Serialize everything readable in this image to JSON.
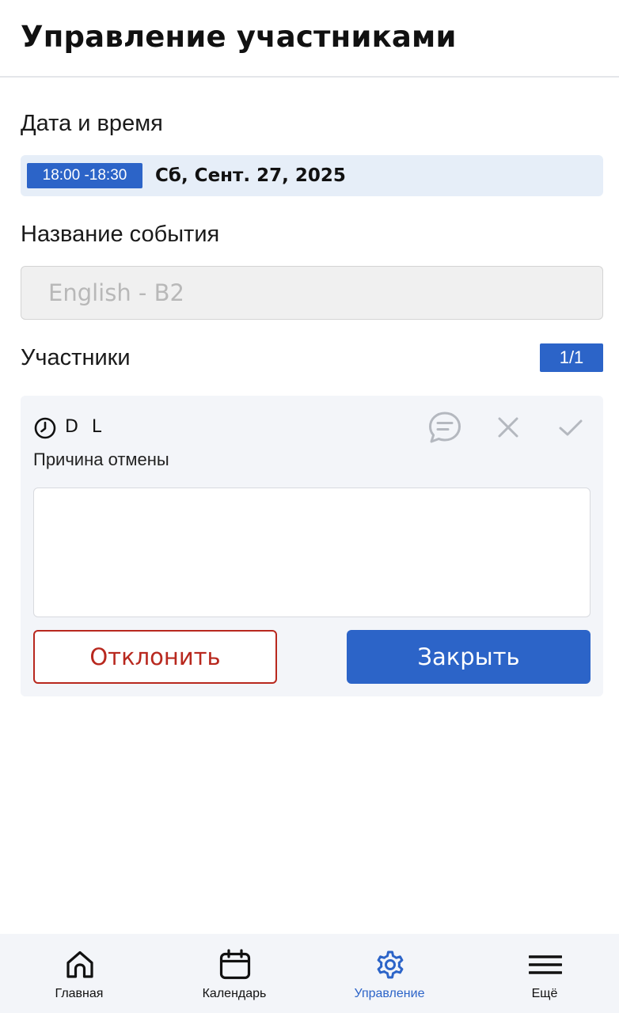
{
  "header": {
    "title": "Управление участниками"
  },
  "datetime": {
    "label": "Дата и время",
    "time_range": "18:00 -18:30",
    "date": "Сб, Сент. 27, 2025"
  },
  "event": {
    "label": "Название события",
    "name_placeholder": "English - B2"
  },
  "participants": {
    "label": "Участники",
    "count": "1/1",
    "items": [
      {
        "name": "D L",
        "status_icon": "clock-icon",
        "actions": [
          "chat-icon",
          "close-icon",
          "check-icon"
        ],
        "reason_label": "Причина отмены",
        "reason_value": "",
        "reject_label": "Отклонить",
        "close_label": "Закрыть"
      }
    ]
  },
  "nav": {
    "items": [
      {
        "label": "Главная",
        "icon": "home-icon",
        "active": false
      },
      {
        "label": "Календарь",
        "icon": "calendar-icon",
        "active": false
      },
      {
        "label": "Управление",
        "icon": "gear-icon",
        "active": true
      },
      {
        "label": "Ещё",
        "icon": "menu-icon",
        "active": false
      }
    ]
  },
  "colors": {
    "accent": "#2c64c8",
    "danger": "#b8281e",
    "highlight_bg": "#e6eef8",
    "card_bg": "#f3f5f9",
    "icon_muted": "#b4b8bf"
  }
}
